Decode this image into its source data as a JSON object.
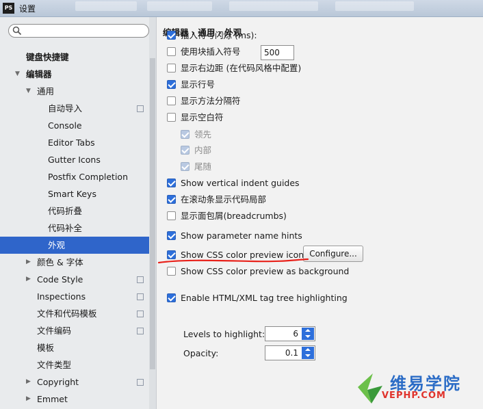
{
  "window": {
    "logo_text": "PS",
    "title": "设置"
  },
  "search": {
    "placeholder": "",
    "value": ""
  },
  "tree": [
    {
      "label": "键盘快捷键",
      "level": 0,
      "bold": true,
      "arrow": "",
      "copy": false
    },
    {
      "label": "编辑器",
      "level": 0,
      "bold": true,
      "arrow": "expanded",
      "copy": false
    },
    {
      "label": "通用",
      "level": 1,
      "bold": false,
      "arrow": "expanded",
      "copy": false
    },
    {
      "label": "自动导入",
      "level": 2,
      "bold": false,
      "arrow": "",
      "copy": true
    },
    {
      "label": "Console",
      "level": 2,
      "bold": false,
      "arrow": "",
      "copy": false
    },
    {
      "label": "Editor Tabs",
      "level": 2,
      "bold": false,
      "arrow": "",
      "copy": false
    },
    {
      "label": "Gutter Icons",
      "level": 2,
      "bold": false,
      "arrow": "",
      "copy": false
    },
    {
      "label": "Postfix Completion",
      "level": 2,
      "bold": false,
      "arrow": "",
      "copy": false
    },
    {
      "label": "Smart Keys",
      "level": 2,
      "bold": false,
      "arrow": "",
      "copy": false
    },
    {
      "label": "代码折叠",
      "level": 2,
      "bold": false,
      "arrow": "",
      "copy": false
    },
    {
      "label": "代码补全",
      "level": 2,
      "bold": false,
      "arrow": "",
      "copy": false
    },
    {
      "label": "外观",
      "level": 2,
      "bold": false,
      "arrow": "",
      "copy": false,
      "selected": true
    },
    {
      "label": "颜色 & 字体",
      "level": 1,
      "bold": false,
      "arrow": "collapsed",
      "copy": false
    },
    {
      "label": "Code Style",
      "level": 1,
      "bold": false,
      "arrow": "collapsed",
      "copy": true
    },
    {
      "label": "Inspections",
      "level": 1,
      "bold": false,
      "arrow": "",
      "copy": true
    },
    {
      "label": "文件和代码模板",
      "level": 1,
      "bold": false,
      "arrow": "",
      "copy": true
    },
    {
      "label": "文件编码",
      "level": 1,
      "bold": false,
      "arrow": "",
      "copy": true
    },
    {
      "label": "模板",
      "level": 1,
      "bold": false,
      "arrow": "",
      "copy": false
    },
    {
      "label": "文件类型",
      "level": 1,
      "bold": false,
      "arrow": "",
      "copy": false
    },
    {
      "label": "Copyright",
      "level": 1,
      "bold": false,
      "arrow": "collapsed",
      "copy": true
    },
    {
      "label": "Emmet",
      "level": 1,
      "bold": false,
      "arrow": "collapsed",
      "copy": false
    }
  ],
  "main": {
    "breadcrumb": "编辑器 › 通用 › 外观",
    "options": [
      {
        "label": "插入符号闪烁 (ms):",
        "checked": true,
        "disabled": false,
        "indent": 0
      },
      {
        "label": "使用块插入符号",
        "checked": false,
        "disabled": false,
        "indent": 0
      },
      {
        "label": "显示右边距 (在代码风格中配置)",
        "checked": false,
        "disabled": false,
        "indent": 0
      },
      {
        "label": "显示行号",
        "checked": true,
        "disabled": false,
        "indent": 0
      },
      {
        "label": "显示方法分隔符",
        "checked": false,
        "disabled": false,
        "indent": 0
      },
      {
        "label": "显示空白符",
        "checked": false,
        "disabled": false,
        "indent": 0
      },
      {
        "label": "领先",
        "checked": true,
        "disabled": true,
        "indent": 1
      },
      {
        "label": "内部",
        "checked": true,
        "disabled": true,
        "indent": 1
      },
      {
        "label": "尾随",
        "checked": true,
        "disabled": true,
        "indent": 1
      },
      {
        "label": "Show vertical indent guides",
        "checked": true,
        "disabled": false,
        "indent": 0
      },
      {
        "label": "在滚动条显示代码局部",
        "checked": true,
        "disabled": false,
        "indent": 0
      },
      {
        "label": "显示面包屑(breadcrumbs)",
        "checked": false,
        "disabled": false,
        "indent": 0
      },
      {
        "label": "Show parameter name hints",
        "checked": true,
        "disabled": false,
        "indent": 0
      },
      {
        "label": "Show CSS color preview icon in gutter",
        "checked": true,
        "disabled": false,
        "indent": 0
      },
      {
        "label": "Show CSS color preview as background",
        "checked": false,
        "disabled": false,
        "indent": 0
      },
      {
        "label": "Enable HTML/XML tag tree highlighting",
        "checked": true,
        "disabled": false,
        "indent": 0
      }
    ],
    "caret_blink_value": "500",
    "configure_label": "Configure...",
    "levels_label": "Levels to highlight:",
    "levels_value": "6",
    "opacity_label": "Opacity:",
    "opacity_value": "0.1"
  },
  "watermark": {
    "cn": "维易学院",
    "en": "VEPHP.COM"
  },
  "colors": {
    "selection": "#2f65ca",
    "checkbox_on": "#2d6fdb",
    "annotation": "#e8211a"
  }
}
